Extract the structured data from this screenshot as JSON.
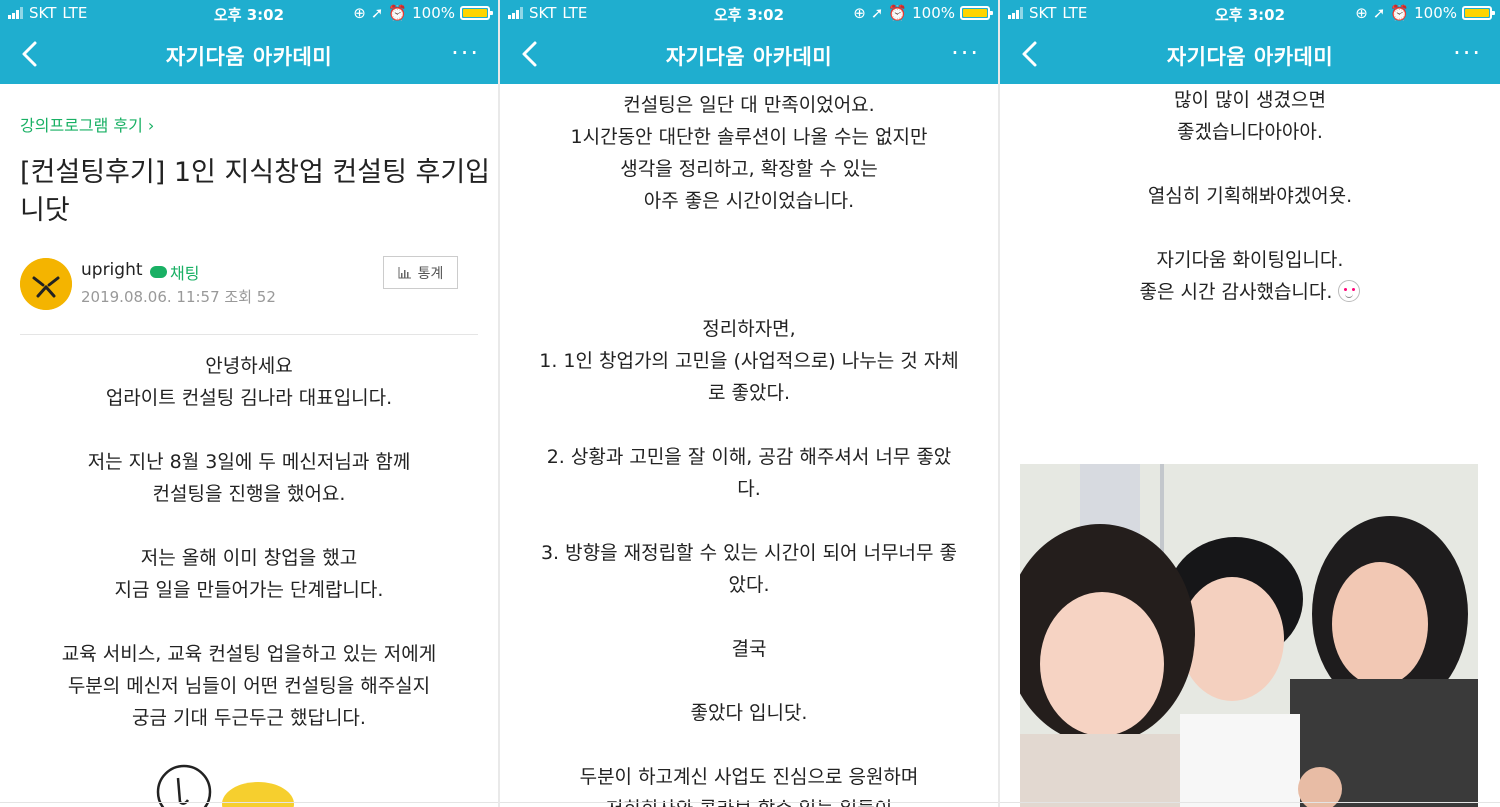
{
  "status_bar": {
    "carrier": "SKT",
    "network": "LTE",
    "time": "오후 3:02",
    "battery": "100%",
    "battery_color": "#ffd400"
  },
  "nav": {
    "title": "자기다움 아카데미",
    "back_icon": "chevron-left-icon",
    "more_label": "···",
    "bar_color": "#1faecf"
  },
  "panel1": {
    "category": "강의프로그램 후기 ›",
    "post_title": "[컨설팅후기] 1인 지식창업 컨설팅 후기입니닷",
    "author": "upright",
    "chat_label": "채팅",
    "meta": "2019.08.06. 11:57 조회 52",
    "stats_label": "통계",
    "body": [
      "안녕하세요",
      "업라이트 컨설팅 김나라 대표입니다.",
      "",
      "저는 지난 8월 3일에 두 메신저님과 함께",
      "컨설팅을 진행을 했어요.",
      "",
      "저는 올해 이미 창업을 했고",
      "지금 일을 만들어가는 단계랍니다.",
      "",
      "교육 서비스, 교육 컨설팅 업을하고 있는 저에게",
      "두분의 메신저 님들이 어떤 컨설팅을 해주실지",
      "궁금 기대 두근두근 했답니다."
    ]
  },
  "panel2": {
    "body": [
      "컨설팅은 일단 대 만족이었어요.",
      "1시간동안 대단한 솔루션이 나올 수는 없지만",
      "생각을 정리하고, 확장할 수 있는",
      "아주 좋은 시간이었습니다.",
      "",
      "",
      "",
      "정리하자면,",
      "1. 1인 창업가의 고민을 (사업적으로) 나누는 것 자체",
      "로 좋았다.",
      "",
      "2. 상황과 고민을 잘 이해, 공감 해주셔서 너무 좋았",
      "다.",
      "",
      "3. 방향을 재정립할 수 있는 시간이 되어 너무너무 좋",
      "았다.",
      "",
      "결국",
      "",
      "좋았다 입니닷.",
      "",
      "두분이 하고계신 사업도 진심으로 응원하며",
      "저희회사와 콜라보 할수 있는 일들이"
    ]
  },
  "panel3": {
    "body": [
      "많이 많이 생겼으면",
      "좋겠습니다아아아.",
      "",
      "열심히 기획해봐야겠어욧.",
      "",
      "자기다움 화이팅입니다.",
      "좋은 시간 감사했습니다."
    ]
  },
  "accent_green": "#19b064"
}
